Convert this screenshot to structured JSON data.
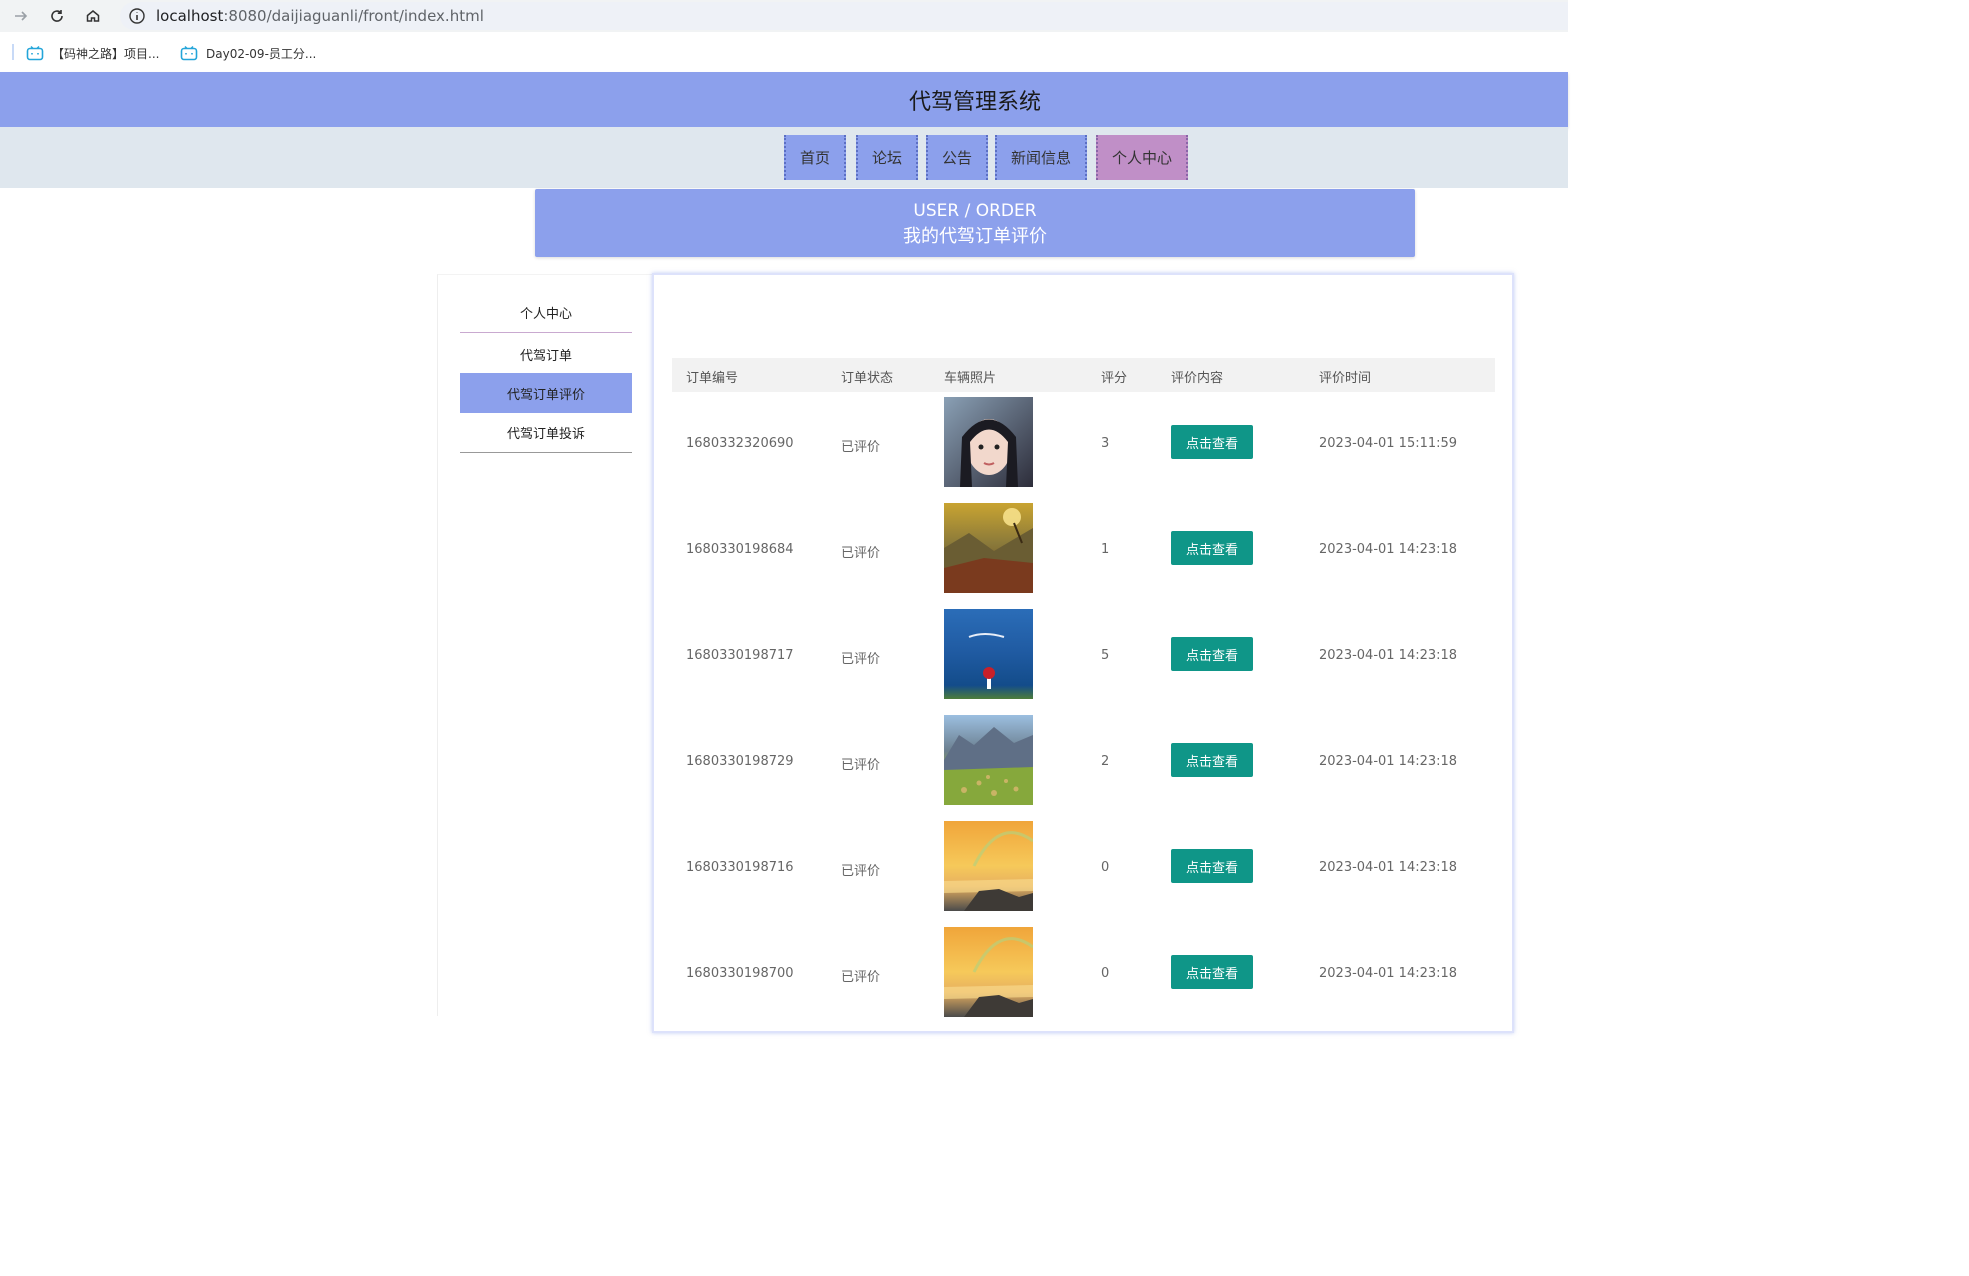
{
  "browser": {
    "url_host": "localhost",
    "url_rest": ":8080/daijiaguanli/front/index.html",
    "bookmarks": [
      {
        "label": "【码神之路】项目..."
      },
      {
        "label": "Day02-09-员工分..."
      }
    ]
  },
  "site": {
    "title": "代驾管理系统",
    "nav": [
      {
        "label": "首页"
      },
      {
        "label": "论坛"
      },
      {
        "label": "公告"
      },
      {
        "label": "新闻信息"
      },
      {
        "label": "个人中心"
      }
    ],
    "active_nav": "个人中心"
  },
  "banner": {
    "en": "USER / ORDER",
    "cn": "我的代驾订单评价"
  },
  "side_menu": [
    {
      "label": "个人中心"
    },
    {
      "label": "代驾订单"
    },
    {
      "label": "代驾订单评价"
    },
    {
      "label": "代驾订单投诉"
    }
  ],
  "active_side": "代驾订单评价",
  "table": {
    "headers": [
      "订单编号",
      "订单状态",
      "车辆照片",
      "评分",
      "评价内容",
      "评价时间"
    ],
    "button_label": "点击查看",
    "rows": [
      {
        "order_no": "1680332320690",
        "status": "已评价",
        "photo": "portrait-girl",
        "score": "3",
        "time": "2023-04-01 15:11:59"
      },
      {
        "order_no": "1680330198684",
        "status": "已评价",
        "photo": "mountain-sunset",
        "score": "1",
        "time": "2023-04-01 14:23:18"
      },
      {
        "order_no": "1680330198717",
        "status": "已评价",
        "photo": "blue-lake",
        "score": "5",
        "time": "2023-04-01 14:23:18"
      },
      {
        "order_no": "1680330198729",
        "status": "已评价",
        "photo": "mountain-meadow",
        "score": "2",
        "time": "2023-04-01 14:23:18"
      },
      {
        "order_no": "1680330198716",
        "status": "已评价",
        "photo": "rainbow-sea",
        "score": "0",
        "time": "2023-04-01 14:23:18"
      },
      {
        "order_no": "1680330198700",
        "status": "已评价",
        "photo": "rainbow-sea",
        "score": "0",
        "time": "2023-04-01 14:23:18"
      }
    ]
  },
  "colors": {
    "header": "#8ca0ec",
    "active_nav": "#c08fc7",
    "button": "#0f9688"
  }
}
